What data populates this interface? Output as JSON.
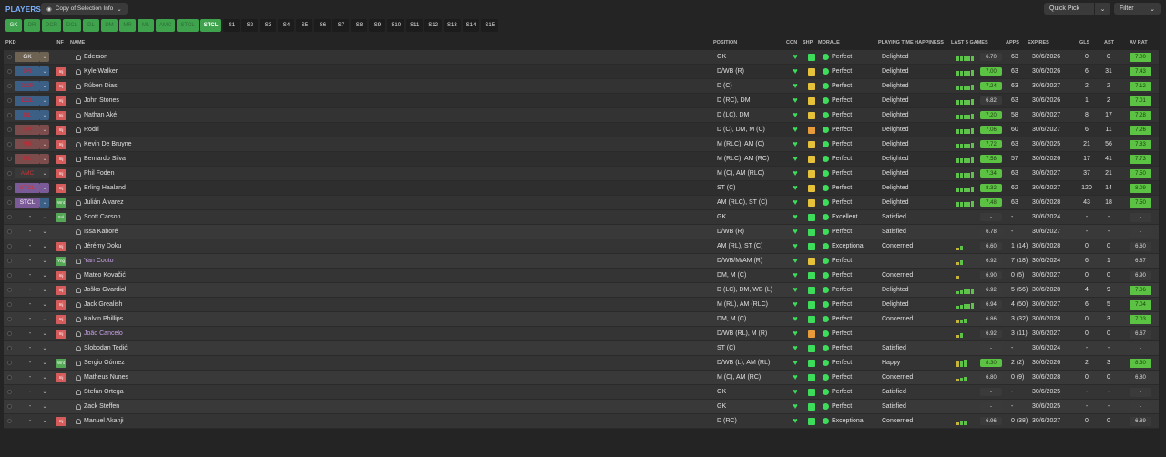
{
  "header": {
    "title": "PLAYERS",
    "view_label": "Copy of Selection Info",
    "quick_pick": "Quick Pick",
    "filter": "Filter"
  },
  "tabs": [
    "GK",
    "DR",
    "DCR",
    "DCL",
    "DL",
    "DM",
    "MR",
    "ML",
    "AMC",
    "STCL",
    "STCL",
    "S1",
    "S2",
    "S3",
    "S4",
    "S5",
    "S6",
    "S7",
    "S8",
    "S9",
    "S10",
    "S11",
    "S12",
    "S13",
    "S14",
    "S15"
  ],
  "columns": {
    "pkd": "PKD",
    "inf": "INF",
    "name": "NAME",
    "position": "POSITION",
    "con": "CON",
    "shp": "SHP",
    "morale": "MORALE",
    "pth": "PLAYING TIME HAPPINESS",
    "last5": "LAST 5 GAMES",
    "apps": "APPS",
    "expires": "EXPIRES",
    "gls": "GLS",
    "ast": "AST",
    "avrat": "AV RAT"
  },
  "players": [
    {
      "pkd": "GK",
      "pkd_cls": "gk",
      "inf": "",
      "name": "Ederson",
      "pos": "GK",
      "shp": "g",
      "morale": "Perfect",
      "pth": "Delighted",
      "form": "6.70",
      "form_style": "d",
      "bars": [
        5,
        5,
        5,
        5,
        6
      ],
      "apps": "63",
      "exp": "30/6/2026",
      "gls": "0",
      "ast": "0",
      "av": "7.00",
      "av_style": "g"
    },
    {
      "pkd": "DR",
      "pkd_cls": "def",
      "inf": "Inj",
      "inf_cls": "red",
      "name": "Kyle Walker",
      "pos": "D/WB (R)",
      "shp": "y",
      "morale": "Perfect",
      "pth": "Delighted",
      "form": "7.00",
      "form_style": "g",
      "bars": [
        5,
        5,
        5,
        5,
        6
      ],
      "apps": "63",
      "exp": "30/6/2026",
      "gls": "6",
      "ast": "31",
      "av": "7.43",
      "av_style": "g"
    },
    {
      "pkd": "DCR",
      "pkd_cls": "def",
      "inf": "Inj",
      "inf_cls": "red",
      "name": "Rúben Dias",
      "pos": "D (C)",
      "shp": "y",
      "morale": "Perfect",
      "pth": "Delighted",
      "form": "7.24",
      "form_style": "g",
      "bars": [
        5,
        5,
        5,
        5,
        6
      ],
      "apps": "63",
      "exp": "30/6/2027",
      "gls": "2",
      "ast": "2",
      "av": "7.12",
      "av_style": "g"
    },
    {
      "pkd": "DCL",
      "pkd_cls": "def",
      "inf": "Inj",
      "inf_cls": "red",
      "name": "John Stones",
      "pos": "D (RC), DM",
      "shp": "y",
      "morale": "Perfect",
      "pth": "Delighted",
      "form": "6.82",
      "form_style": "d",
      "bars": [
        5,
        5,
        5,
        5,
        6
      ],
      "apps": "63",
      "exp": "30/6/2026",
      "gls": "1",
      "ast": "2",
      "av": "7.01",
      "av_style": "g"
    },
    {
      "pkd": "DL",
      "pkd_cls": "def",
      "inf": "Inj",
      "inf_cls": "red",
      "name": "Nathan Aké",
      "pos": "D (LC), DM",
      "shp": "y",
      "morale": "Perfect",
      "pth": "Delighted",
      "form": "7.20",
      "form_style": "g",
      "bars": [
        5,
        5,
        5,
        5,
        6
      ],
      "apps": "58",
      "exp": "30/6/2027",
      "gls": "8",
      "ast": "17",
      "av": "7.28",
      "av_style": "g"
    },
    {
      "pkd": "DM",
      "pkd_cls": "mid",
      "inf": "Inj",
      "inf_cls": "red",
      "name": "Rodri",
      "pos": "D (C), DM, M (C)",
      "shp": "o",
      "morale": "Perfect",
      "pth": "Delighted",
      "form": "7.06",
      "form_style": "g",
      "bars": [
        5,
        5,
        5,
        5,
        6
      ],
      "apps": "60",
      "exp": "30/6/2027",
      "gls": "6",
      "ast": "11",
      "av": "7.26",
      "av_style": "g"
    },
    {
      "pkd": "MR",
      "pkd_cls": "mid",
      "inf": "Inj",
      "inf_cls": "red",
      "name": "Kevin De Bruyne",
      "pos": "M (RLC), AM (C)",
      "shp": "y",
      "morale": "Perfect",
      "pth": "Delighted",
      "form": "7.72",
      "form_style": "g",
      "bars": [
        5,
        5,
        5,
        5,
        6
      ],
      "apps": "63",
      "exp": "30/6/2025",
      "gls": "21",
      "ast": "56",
      "av": "7.83",
      "av_style": "g"
    },
    {
      "pkd": "ML",
      "pkd_cls": "mid",
      "inf": "Inj",
      "inf_cls": "red",
      "name": "Bernardo Silva",
      "pos": "M (RLC), AM (RC)",
      "shp": "y",
      "morale": "Perfect",
      "pth": "Delighted",
      "form": "7.58",
      "form_style": "g",
      "bars": [
        5,
        5,
        5,
        5,
        6
      ],
      "apps": "57",
      "exp": "30/6/2026",
      "gls": "17",
      "ast": "41",
      "av": "7.73",
      "av_style": "g"
    },
    {
      "pkd": "AMC",
      "pkd_cls": "amc",
      "inf": "Inj",
      "inf_cls": "red",
      "name": "Phil Foden",
      "pos": "M (C), AM (RLC)",
      "shp": "y",
      "morale": "Perfect",
      "pth": "Delighted",
      "form": "7.34",
      "form_style": "g",
      "bars": [
        5,
        5,
        5,
        5,
        6
      ],
      "apps": "63",
      "exp": "30/6/2027",
      "gls": "37",
      "ast": "21",
      "av": "7.50",
      "av_style": "g"
    },
    {
      "pkd": "STCL",
      "pkd_cls": "st",
      "inf": "Inj",
      "inf_cls": "red",
      "name": "Erling Haaland",
      "pos": "ST (C)",
      "shp": "y",
      "morale": "Perfect",
      "pth": "Delighted",
      "form": "8.32",
      "form_style": "g",
      "bars": [
        5,
        5,
        5,
        5,
        6
      ],
      "apps": "62",
      "exp": "30/6/2027",
      "gls": "120",
      "ast": "14",
      "av": "8.09",
      "av_style": "g"
    },
    {
      "pkd": "STCL",
      "pkd_cls": "stcl",
      "inf": "Wnt",
      "inf_cls": "green",
      "name": "Julián Álvarez",
      "pos": "AM (RLC), ST (C)",
      "shp": "y",
      "morale": "Perfect",
      "pth": "Delighted",
      "form": "7.48",
      "form_style": "g",
      "bars": [
        5,
        5,
        5,
        5,
        6
      ],
      "apps": "63",
      "exp": "30/6/2028",
      "gls": "43",
      "ast": "18",
      "av": "7.50",
      "av_style": "g"
    },
    {
      "pkd": "-",
      "inf": "Sol",
      "inf_cls": "green",
      "name": "Scott Carson",
      "pos": "GK",
      "shp": "g",
      "morale": "Excellent",
      "pth": "Satisfied",
      "form": "-",
      "form_style": "d",
      "bars": [],
      "apps": "-",
      "exp": "30/6/2024",
      "gls": "-",
      "ast": "-",
      "av": "-",
      "av_style": "d"
    },
    {
      "pkd": "-",
      "inf": "",
      "name": "Issa Kaboré",
      "pos": "D/WB (R)",
      "shp": "g",
      "morale": "Perfect",
      "pth": "Satisfied",
      "form": "6.78",
      "form_style": "d",
      "bars": [],
      "apps": "-",
      "exp": "30/6/2027",
      "gls": "-",
      "ast": "-",
      "av": "-",
      "av_style": "d"
    },
    {
      "pkd": "-",
      "inf": "Inj",
      "inf_cls": "red",
      "name": "Jérémy Doku",
      "pos": "AM (RL), ST (C)",
      "shp": "g",
      "morale": "Exceptional",
      "pth": "Concerned",
      "form": "6.60",
      "form_style": "d",
      "bars": [
        3,
        5
      ],
      "apps": "1 (14)",
      "exp": "30/6/2028",
      "gls": "0",
      "ast": "0",
      "av": "6.60",
      "av_style": "d"
    },
    {
      "pkd": "-",
      "inf": "Yng",
      "inf_cls": "green",
      "name": "Yan Couto",
      "name_cls": "purple",
      "pos": "D/WB/M/AM (R)",
      "shp": "y",
      "morale": "Perfect",
      "pth": "",
      "form": "6.92",
      "form_style": "d",
      "bars": [
        3,
        5
      ],
      "apps": "7 (18)",
      "exp": "30/6/2024",
      "gls": "6",
      "ast": "1",
      "av": "6.87",
      "av_style": "d"
    },
    {
      "pkd": "-",
      "inf": "Inj",
      "inf_cls": "red",
      "name": "Mateo Kovačić",
      "pos": "DM, M (C)",
      "shp": "g",
      "morale": "Perfect",
      "pth": "Concerned",
      "form": "6.90",
      "form_style": "d",
      "bars": [
        4
      ],
      "apps": "0 (5)",
      "exp": "30/6/2027",
      "gls": "0",
      "ast": "0",
      "av": "6.90",
      "av_style": "d"
    },
    {
      "pkd": "-",
      "inf": "Inj",
      "inf_cls": "red",
      "name": "Joško Gvardiol",
      "pos": "D (LC), DM, WB (L)",
      "shp": "g",
      "morale": "Perfect",
      "pth": "Delighted",
      "form": "6.92",
      "form_style": "d",
      "bars": [
        3,
        4,
        5,
        5,
        6
      ],
      "apps": "5 (56)",
      "exp": "30/6/2028",
      "gls": "4",
      "ast": "9",
      "av": "7.06",
      "av_style": "g"
    },
    {
      "pkd": "-",
      "inf": "Inj",
      "inf_cls": "red",
      "name": "Jack Grealish",
      "pos": "M (RL), AM (RLC)",
      "shp": "g",
      "morale": "Perfect",
      "pth": "Delighted",
      "form": "6.94",
      "form_style": "d",
      "bars": [
        3,
        4,
        5,
        5,
        6
      ],
      "apps": "4 (50)",
      "exp": "30/6/2027",
      "gls": "6",
      "ast": "5",
      "av": "7.04",
      "av_style": "g"
    },
    {
      "pkd": "-",
      "inf": "Inj",
      "inf_cls": "red",
      "name": "Kalvin Phillips",
      "pos": "DM, M (C)",
      "shp": "g",
      "morale": "Perfect",
      "pth": "Concerned",
      "form": "6.86",
      "form_style": "d",
      "bars": [
        3,
        4,
        5
      ],
      "apps": "3 (32)",
      "exp": "30/6/2028",
      "gls": "0",
      "ast": "3",
      "av": "7.03",
      "av_style": "g"
    },
    {
      "pkd": "-",
      "inf": "Inj",
      "inf_cls": "red",
      "name": "João Cancelo",
      "name_cls": "purple",
      "pos": "D/WB (RL), M (R)",
      "shp": "o",
      "morale": "Perfect",
      "pth": "",
      "form": "6.92",
      "form_style": "d",
      "bars": [
        3,
        5
      ],
      "apps": "3 (11)",
      "exp": "30/6/2027",
      "gls": "0",
      "ast": "0",
      "av": "6.67",
      "av_style": "d"
    },
    {
      "pkd": "-",
      "inf": "",
      "name": "Slobodan Tedić",
      "pos": "ST (C)",
      "shp": "g",
      "morale": "Perfect",
      "pth": "Satisfied",
      "form": "-",
      "form_style": "d",
      "bars": [],
      "apps": "-",
      "exp": "30/6/2024",
      "gls": "-",
      "ast": "-",
      "av": "-",
      "av_style": "d"
    },
    {
      "pkd": "-",
      "inf": "Wnt",
      "inf_cls": "green",
      "name": "Sergio Gómez",
      "pos": "D/WB (L), AM (RL)",
      "shp": "g",
      "morale": "Perfect",
      "pth": "Happy",
      "form": "8.30",
      "form_style": "g",
      "bars": [
        6,
        7,
        8
      ],
      "apps": "2 (2)",
      "exp": "30/6/2026",
      "gls": "2",
      "ast": "3",
      "av": "8.30",
      "av_style": "g"
    },
    {
      "pkd": "-",
      "inf": "Inj",
      "inf_cls": "red",
      "name": "Matheus Nunes",
      "pos": "M (C), AM (RC)",
      "shp": "g",
      "morale": "Perfect",
      "pth": "Concerned",
      "form": "6.80",
      "form_style": "d",
      "bars": [
        3,
        4,
        5
      ],
      "apps": "0 (9)",
      "exp": "30/6/2028",
      "gls": "0",
      "ast": "0",
      "av": "6.80",
      "av_style": "d"
    },
    {
      "pkd": "-",
      "inf": "",
      "name": "Stefan Ortega",
      "pos": "GK",
      "shp": "g",
      "morale": "Perfect",
      "pth": "Satisfied",
      "form": "-",
      "form_style": "d",
      "bars": [],
      "apps": "-",
      "exp": "30/6/2025",
      "gls": "-",
      "ast": "-",
      "av": "-",
      "av_style": "d"
    },
    {
      "pkd": "-",
      "inf": "",
      "name": "Zack Steffen",
      "pos": "GK",
      "shp": "g",
      "morale": "Perfect",
      "pth": "Satisfied",
      "form": "-",
      "form_style": "d",
      "bars": [],
      "apps": "-",
      "exp": "30/6/2025",
      "gls": "-",
      "ast": "-",
      "av": "-",
      "av_style": "d"
    },
    {
      "pkd": "-",
      "inf": "Inj",
      "inf_cls": "red",
      "name": "Manuel Akanji",
      "pos": "D (RC)",
      "shp": "g",
      "morale": "Exceptional",
      "pth": "Concerned",
      "form": "6.96",
      "form_style": "d",
      "bars": [
        3,
        4,
        5
      ],
      "apps": "0 (38)",
      "exp": "30/6/2027",
      "gls": "0",
      "ast": "0",
      "av": "6.89",
      "av_style": "d"
    }
  ]
}
